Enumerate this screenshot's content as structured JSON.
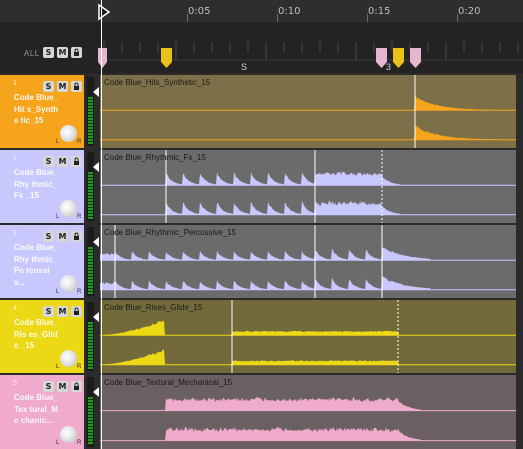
{
  "ruler": {
    "ticks": [
      "0:05",
      "0:10",
      "0:15",
      "0:20"
    ]
  },
  "header": {
    "all_label": "ALL",
    "solo_label": "S",
    "mute_label": "M",
    "lock_icon": "lock-icon"
  },
  "sections": {
    "label_s": "S",
    "label_3": "3"
  },
  "colors": {
    "orange": "#f7a41d",
    "blue": "#c8c8ff",
    "yellow": "#ecd815",
    "pink": "#f0aacb",
    "marker_yellow": "#e8c21a",
    "marker_pink": "#e6b6cf"
  },
  "tracks": [
    {
      "num": "1",
      "name": "Code Blue_Hits_Synthetic_15",
      "display": "Code Blue_Hit s_Synthe tic_15",
      "clip": "Code Blue_Hits_Synthetic_15",
      "solo": "S",
      "mute": "M",
      "left": "L",
      "right": "R"
    },
    {
      "num": "2",
      "name": "Code Blue_Rhythmic_Fx_15",
      "display": "Code Blue_Rhy thmic_Fx _15",
      "clip": "Code Blue_Rhythmic_Fx_15",
      "solo": "S",
      "mute": "M",
      "left": "L",
      "right": "R"
    },
    {
      "num": "3",
      "name": "Code Blue_Rhythmic_Percussive_15",
      "display": "Code Blue_Rhy thmic_Pe rcussiv...",
      "clip": "Code Blue_Rhythmic_Percussive_15",
      "solo": "S",
      "mute": "M",
      "left": "L",
      "right": "R"
    },
    {
      "num": "4",
      "name": "Code Blue_Rises_Glide_15",
      "display": "Code Blue_Ris es_Glide_ 15",
      "clip": "Code Blue_Rises_Glide_15",
      "solo": "S",
      "mute": "M",
      "left": "L",
      "right": "R"
    },
    {
      "num": "5",
      "name": "Code Blue_Textural_Mechanical_15",
      "display": "Code Blue_Tex tural_Me chanic...",
      "clip": "Code Blue_Textural_Mechanical_15",
      "solo": "S",
      "mute": "M",
      "left": "L",
      "right": "R"
    }
  ]
}
